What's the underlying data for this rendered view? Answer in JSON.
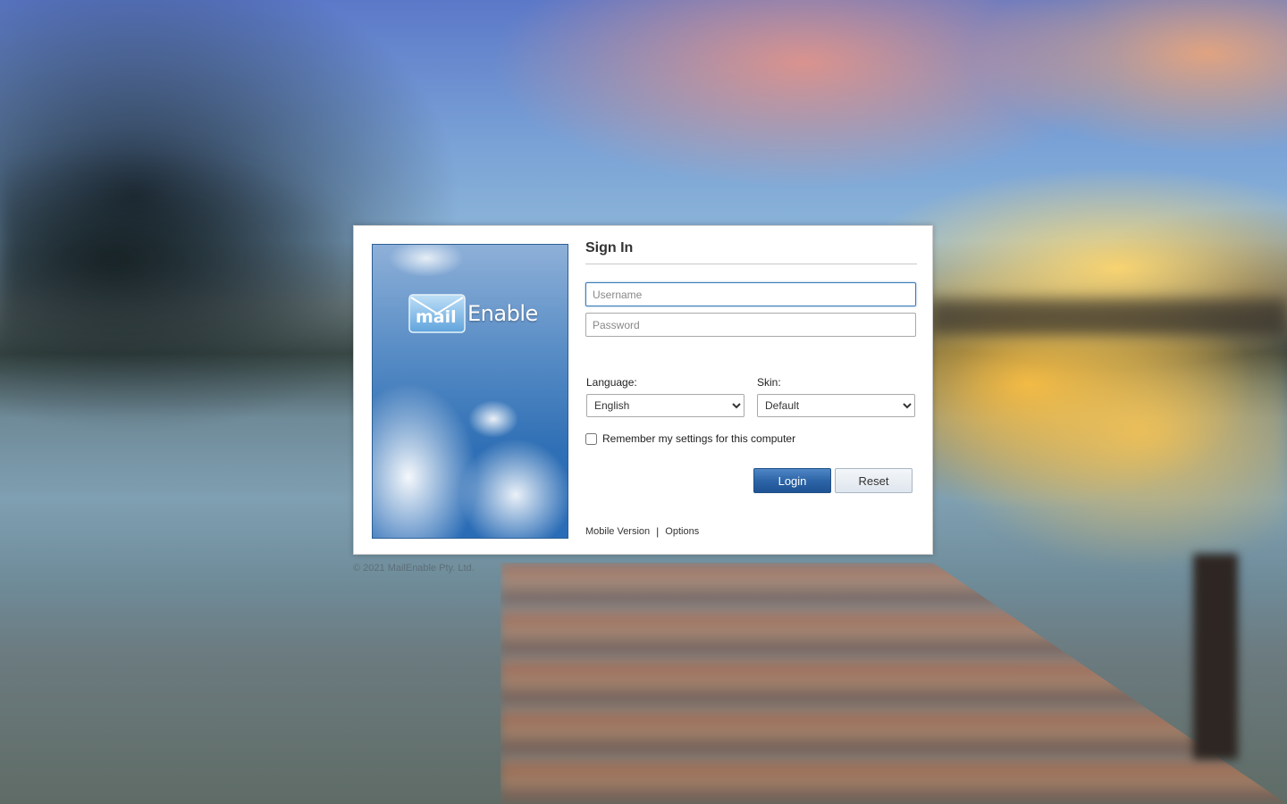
{
  "brand": {
    "logo_word_mail": "mail",
    "logo_word_enable": "Enable"
  },
  "signin": {
    "title": "Sign In",
    "username_placeholder": "Username",
    "password_placeholder": "Password"
  },
  "settings": {
    "language_label": "Language:",
    "language_value": "English",
    "skin_label": "Skin:",
    "skin_value": "Default",
    "remember_label": "Remember my settings for this computer"
  },
  "buttons": {
    "login": "Login",
    "reset": "Reset"
  },
  "links": {
    "mobile": "Mobile Version",
    "separator": "|",
    "options": "Options"
  },
  "footer": {
    "copyright": "© 2021 MailEnable Pty. Ltd."
  },
  "colors": {
    "accent": "#2d65a8",
    "focus": "#3b7cb8"
  }
}
